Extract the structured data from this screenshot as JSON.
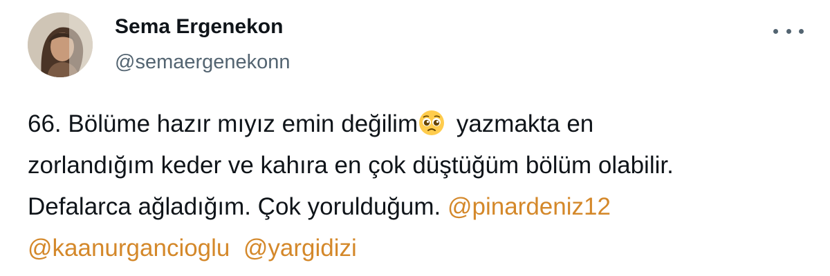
{
  "author": {
    "name": "Sema Ergenekon",
    "handle": "@semaergenekonn"
  },
  "more_icon": "ellipsis-icon",
  "tweet": {
    "line1_a": "66. Bölüme hazır mıyız emin değilim",
    "emoji": "pleading-face-emoji",
    "line1_b": " yazmakta en",
    "line2": "zorlandığım keder ve kahıra en çok düştüğüm bölüm olabilir.",
    "line3_text": "Defalarca ağladığım. Çok yorulduğum. ",
    "mention1": "@pinardeniz12",
    "mention2": "@kaanurgancioglu",
    "mention3": "@yargidizi"
  },
  "colors": {
    "text": "#0f1419",
    "secondary": "#536471",
    "mention": "#d4882a"
  }
}
